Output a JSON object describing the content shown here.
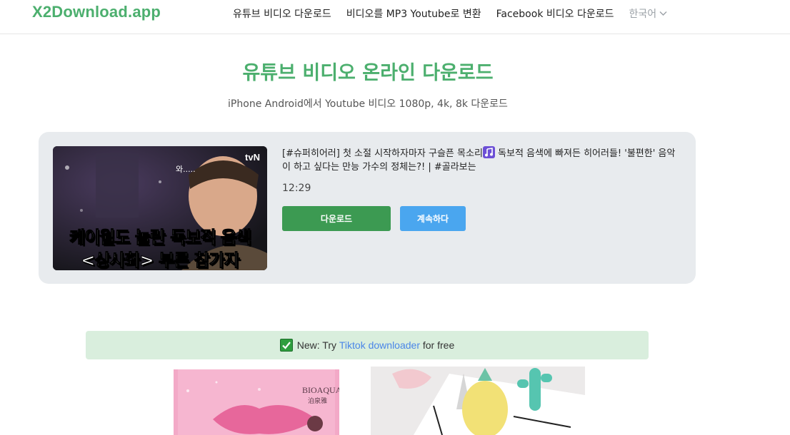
{
  "header": {
    "logo": "X2Download.app",
    "nav": [
      {
        "label": "유튜브 비디오 다운로드"
      },
      {
        "label": "비디오를 MP3 Youtube로 변환"
      },
      {
        "label": "Facebook 비디오 다운로드"
      }
    ],
    "language": "한국어"
  },
  "main": {
    "title": "유튜브 비디오 온라인 다운로드",
    "subtitle": "iPhone Android에서 Youtube 비디오 1080p, 4k, 8k 다운로드"
  },
  "video": {
    "title_part1": "[#슈퍼히어러] 첫 소절 시작하자마자 구슬픈 목소리",
    "title_part2": " 독보적 음색에 빠져든 히어러들! '불편한' 음악이 하고 싶다는 만능 가수의 정체는?! | #골라보는",
    "duration": "12:29",
    "download_label": "다운로드",
    "continue_label": "계속하다",
    "thumbnail": {
      "brand": "tvN",
      "exclaim": "와.....",
      "caption_line1": "케이윌도 놀란 독보적 음색",
      "caption_line2": "<상사화> 부른 참가자"
    }
  },
  "banner": {
    "prefix": "New: Try ",
    "link": "Tiktok downloader",
    "suffix": " for free"
  },
  "ads": {
    "ad1_brand": "BIOAQUA",
    "ad1_sub": "泊泉雅"
  },
  "colors": {
    "brand_green": "#4caf6e",
    "download_button": "#3c9a52",
    "continue_button": "#4aa6ef",
    "card_bg": "#e8ebee",
    "banner_bg": "#d9eedd"
  }
}
